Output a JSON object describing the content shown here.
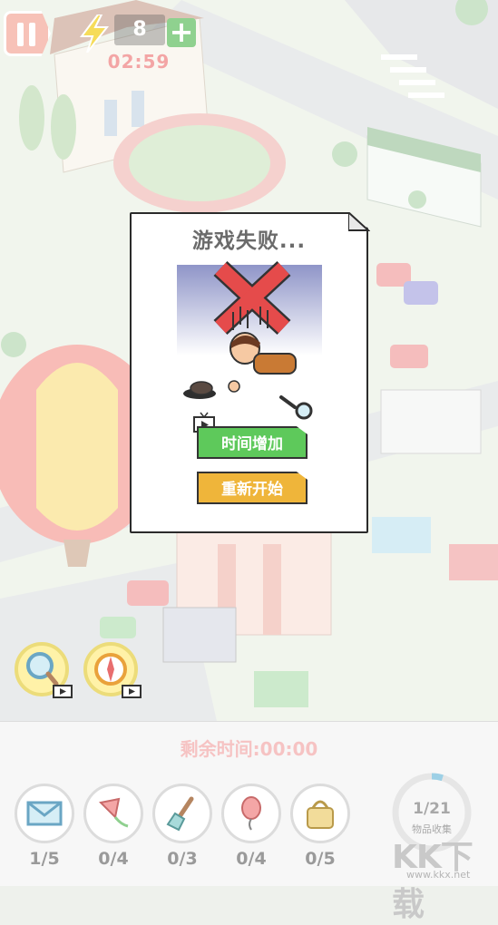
{
  "hud": {
    "energy_count": "8",
    "timer": "02:59",
    "plus_label": "+"
  },
  "dialog": {
    "title": "游戏失败...",
    "add_time_button": "时间增加",
    "restart_button": "重新开始"
  },
  "bottom": {
    "remaining_time_label": "剩余时间:00:00",
    "items": [
      {
        "icon": "envelope-icon",
        "count": "1/5"
      },
      {
        "icon": "kite-icon",
        "count": "0/4"
      },
      {
        "icon": "brush-icon",
        "count": "0/3"
      },
      {
        "icon": "balloon-icon",
        "count": "0/4"
      },
      {
        "icon": "bag-icon",
        "count": "0/5"
      }
    ],
    "collection": {
      "count": "1/21",
      "label": "物品收集",
      "progress_fraction": 0.048
    }
  },
  "colors": {
    "pause_pink": "#f7c2b8",
    "add_time_green": "#5ec95b",
    "restart_yellow": "#efb53a",
    "timer_red": "#f3a5a5"
  },
  "watermark": {
    "logo": "KK下载",
    "url": "www.kkx.net"
  }
}
